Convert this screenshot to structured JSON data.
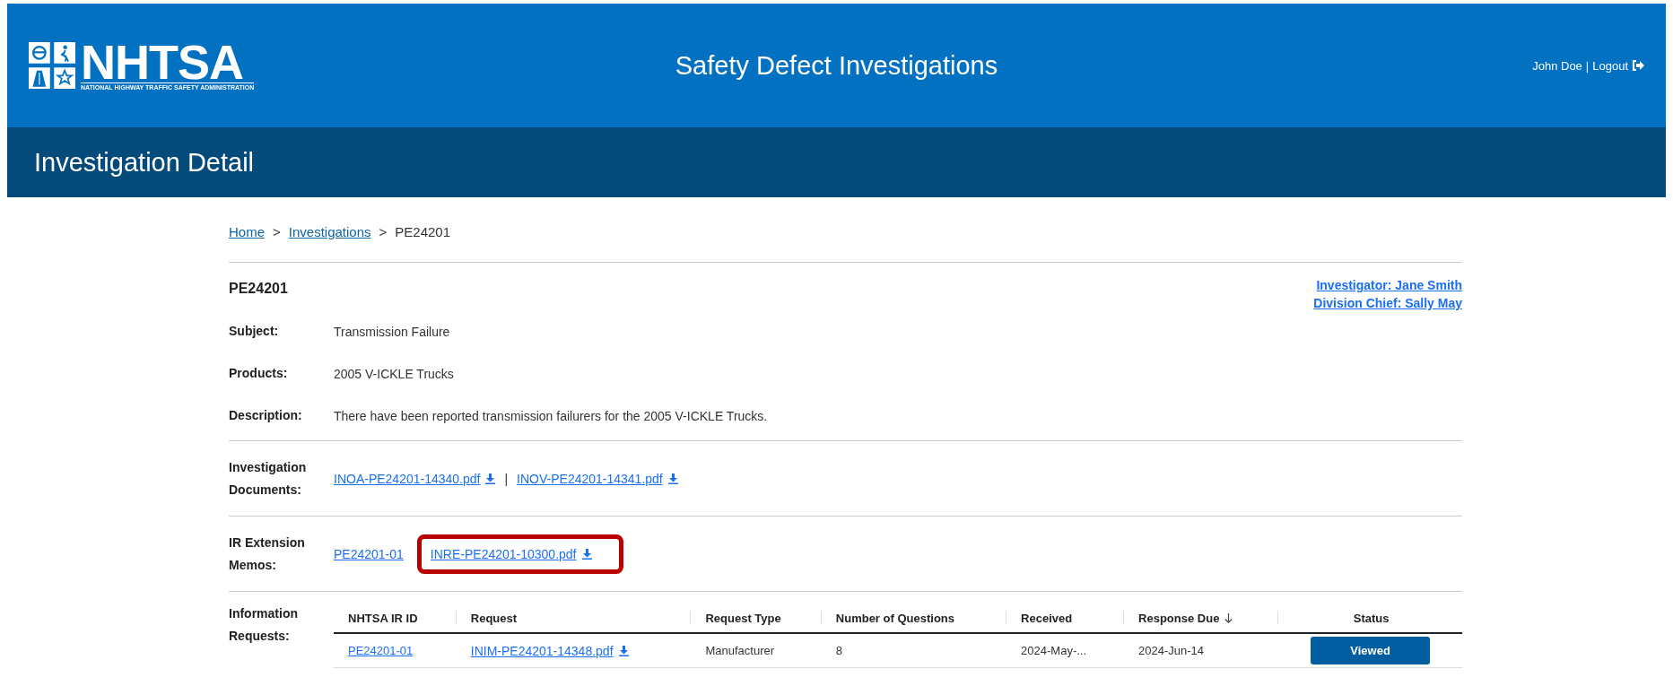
{
  "header": {
    "logo": {
      "name": "NHTSA",
      "tagline": "NATIONAL HIGHWAY TRAFFIC SAFETY ADMINISTRATION"
    },
    "title": "Safety Defect Investigations",
    "user": "John Doe",
    "separator": "|",
    "logout": "Logout"
  },
  "page_title": "Investigation Detail",
  "breadcrumb": [
    {
      "label": "Home",
      "current": false
    },
    {
      "label": "Investigations",
      "current": false
    },
    {
      "label": "PE24201",
      "current": true
    }
  ],
  "breadcrumb_separator": ">",
  "investigation": {
    "id": "PE24201",
    "contacts": [
      "Investigator: Jane Smith",
      "Division Chief: Sally May"
    ],
    "fields": [
      {
        "label": "Subject:",
        "value": "Transmission Failure"
      },
      {
        "label": "Products:",
        "value": "2005 V-ICKLE Trucks"
      },
      {
        "label": "Description:",
        "value": "There have been reported transmission failurers for the 2005 V-ICKLE Trucks."
      }
    ]
  },
  "documents": {
    "label": "Investigation Documents:",
    "separator": "|",
    "files": [
      {
        "name": "INOA-PE24201-14340.pdf"
      },
      {
        "name": "INOV-PE24201-14341.pdf"
      }
    ]
  },
  "memos": {
    "label": "IR Extension Memos:",
    "items": [
      {
        "kind": "link",
        "name": "PE24201-01",
        "highlighted": false
      },
      {
        "kind": "file",
        "name": "INRE-PE24201-10300.pdf",
        "highlighted": true
      }
    ]
  },
  "information_requests": {
    "label": "Information Requests:",
    "columns": [
      {
        "label": "NHTSA IR ID",
        "sorted": false
      },
      {
        "label": "Request",
        "sorted": false
      },
      {
        "label": "Request Type",
        "sorted": false
      },
      {
        "label": "Number of Questions",
        "sorted": false
      },
      {
        "label": "Received",
        "sorted": false
      },
      {
        "label": "Response Due",
        "sorted": true
      },
      {
        "label": "Status",
        "sorted": false
      }
    ],
    "rows": [
      {
        "id": "PE24201-01",
        "request": "INIM-PE24201-14348.pdf",
        "request_type": "Manufacturer",
        "questions": "8",
        "received": "2024-May-...",
        "response_due": "2024-Jun-14",
        "status": "Viewed"
      }
    ]
  }
}
